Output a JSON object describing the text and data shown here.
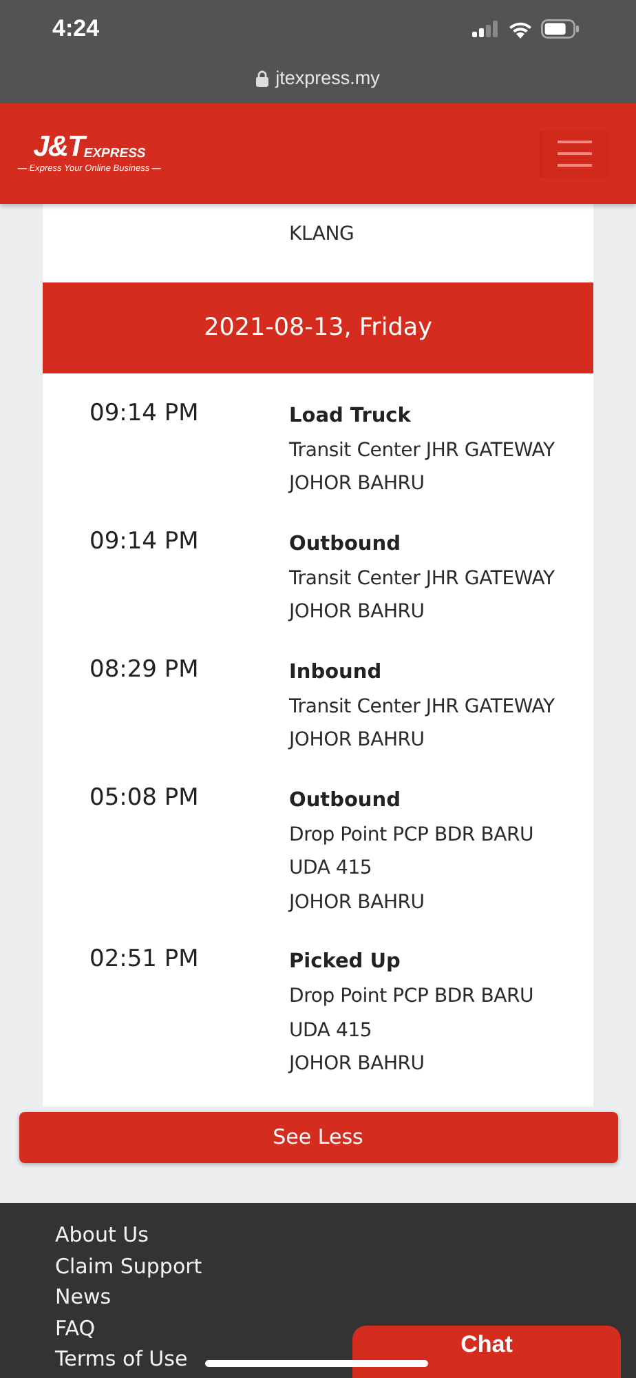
{
  "status_bar": {
    "time": "4:24"
  },
  "address_bar": {
    "url": "jtexpress.my"
  },
  "header": {
    "logo_mark": "J&T",
    "logo_word": "EXPRESS",
    "tagline": "— Express Your Online Business —"
  },
  "previous_lines": [
    "KLANG"
  ],
  "day": {
    "date": "2021-08-13, Friday",
    "events": [
      {
        "time": "09:14 PM",
        "status": "Load Truck",
        "lines": [
          "Transit Center JHR GATEWAY",
          "JOHOR BAHRU"
        ]
      },
      {
        "time": "09:14 PM",
        "status": "Outbound",
        "lines": [
          "Transit Center JHR GATEWAY",
          "JOHOR BAHRU"
        ]
      },
      {
        "time": "08:29 PM",
        "status": "Inbound",
        "lines": [
          "Transit Center JHR GATEWAY",
          "JOHOR BAHRU"
        ]
      },
      {
        "time": "05:08 PM",
        "status": "Outbound",
        "lines": [
          "Drop Point PCP BDR BARU",
          "UDA 415",
          "JOHOR BAHRU"
        ]
      },
      {
        "time": "02:51 PM",
        "status": "Picked Up",
        "lines": [
          "Drop Point PCP BDR BARU",
          "UDA 415",
          "JOHOR BAHRU"
        ]
      }
    ]
  },
  "see_less_button": "See Less",
  "footer_links": [
    "About Us",
    "Claim Support",
    "News",
    "FAQ",
    "Terms of Use"
  ],
  "chat_button": "Chat"
}
